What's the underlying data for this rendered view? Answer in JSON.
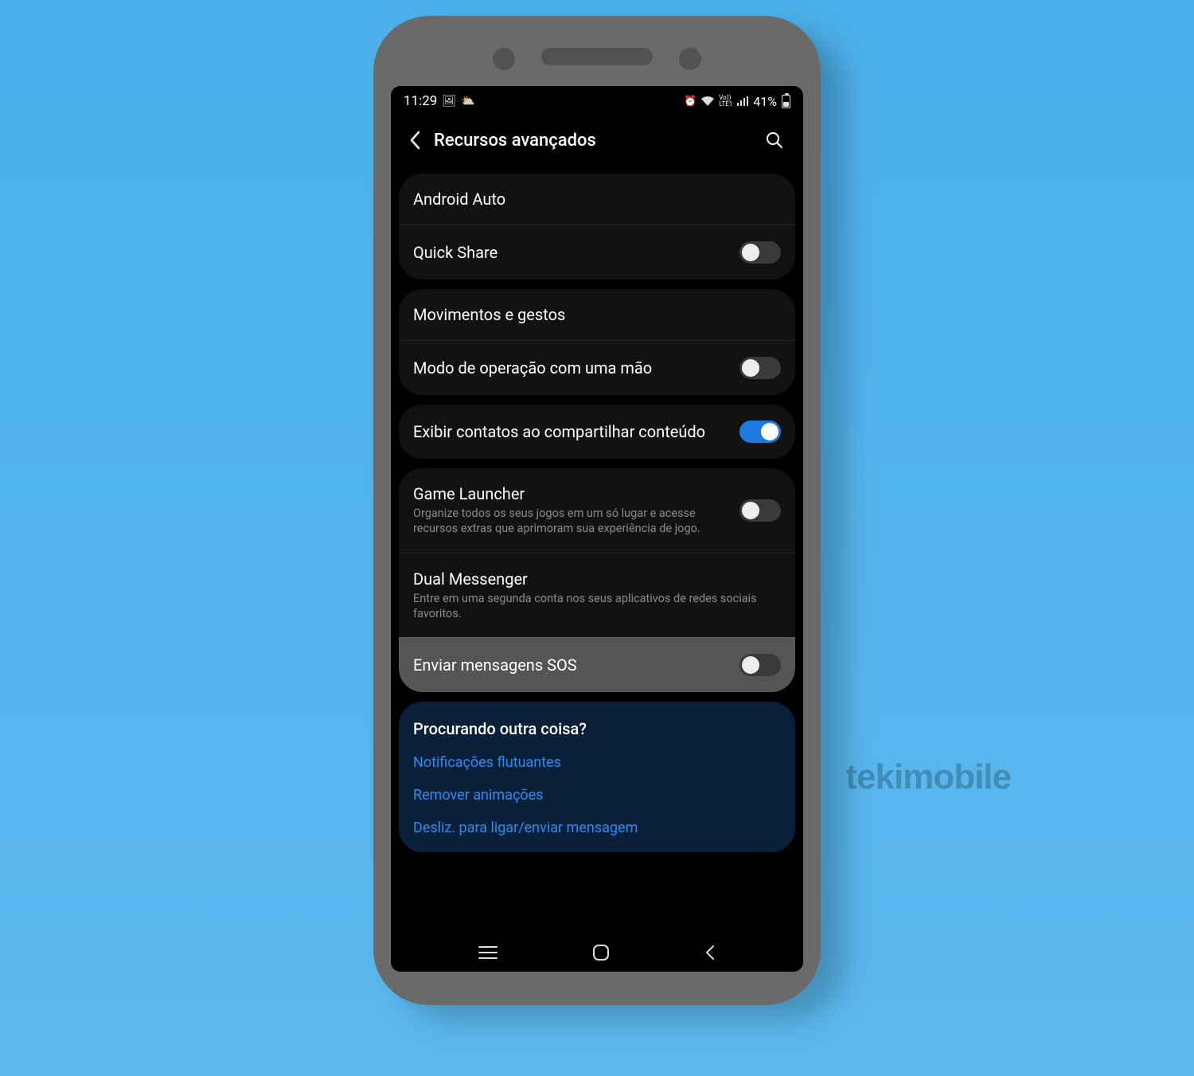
{
  "statusbar": {
    "time": "11:29",
    "battery_pct": "41%",
    "lte_label": "LTE1",
    "vo_label": "Vo))"
  },
  "header": {
    "title": "Recursos avançados"
  },
  "group1": {
    "items": [
      {
        "title": "Android Auto",
        "toggle": null
      },
      {
        "title": "Quick Share",
        "toggle": "off"
      }
    ]
  },
  "group2": {
    "items": [
      {
        "title": "Movimentos e gestos",
        "toggle": null
      },
      {
        "title": "Modo de operação com uma mão",
        "toggle": "off"
      }
    ]
  },
  "group3": {
    "items": [
      {
        "title": "Exibir contatos ao compartilhar conteúdo",
        "toggle": "on"
      }
    ]
  },
  "group4": {
    "items": [
      {
        "title": "Game Launcher",
        "sub": "Organize todos os seus jogos em um só lugar e acesse recursos extras que aprimoram sua experiência de jogo.",
        "toggle": "off"
      },
      {
        "title": "Dual Messenger",
        "sub": "Entre em uma segunda conta nos seus aplicativos de redes sociais favoritos.",
        "toggle": null
      },
      {
        "title": "Enviar mensagens SOS",
        "toggle": "off",
        "highlight": true
      }
    ]
  },
  "looking": {
    "title": "Procurando outra coisa?",
    "links": [
      "Notificações flutuantes",
      "Remover animações",
      "Desliz. para ligar/enviar mensagem"
    ]
  },
  "watermark": "tekimobile"
}
